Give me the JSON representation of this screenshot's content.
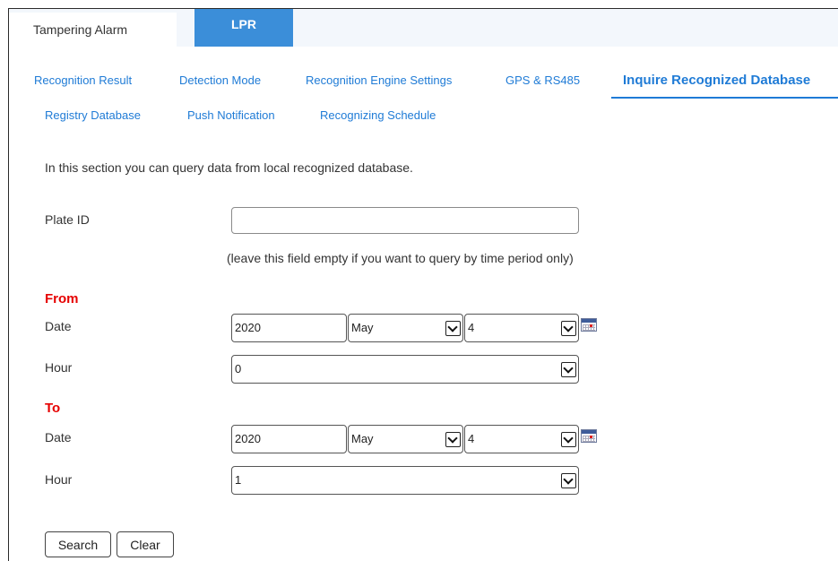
{
  "top_tabs": [
    {
      "label": "Tampering Alarm"
    },
    {
      "label": "LPR"
    }
  ],
  "subnav": [
    "Recognition Result",
    "Detection Mode",
    "Recognition Engine Settings",
    "GPS & RS485",
    "Inquire Recognized Database",
    "Registry Database",
    "Push Notification",
    "Recognizing Schedule"
  ],
  "active_subnav": "Inquire Recognized Database",
  "intro": "In this section you can query data from local recognized database.",
  "plate": {
    "label": "Plate ID",
    "value": "",
    "hint": "(leave this field empty if you want to query by time period only)"
  },
  "from": {
    "heading": "From",
    "date_label": "Date",
    "year": "2020",
    "month": "May",
    "day": "4",
    "hour_label": "Hour",
    "hour": "0"
  },
  "to": {
    "heading": "To",
    "date_label": "Date",
    "year": "2020",
    "month": "May",
    "day": "4",
    "hour_label": "Hour",
    "hour": "1"
  },
  "buttons": {
    "search": "Search",
    "clear": "Clear"
  },
  "colors": {
    "accent": "#3b8ed9",
    "link": "#1f7bd6",
    "section_heading": "#e60000"
  }
}
